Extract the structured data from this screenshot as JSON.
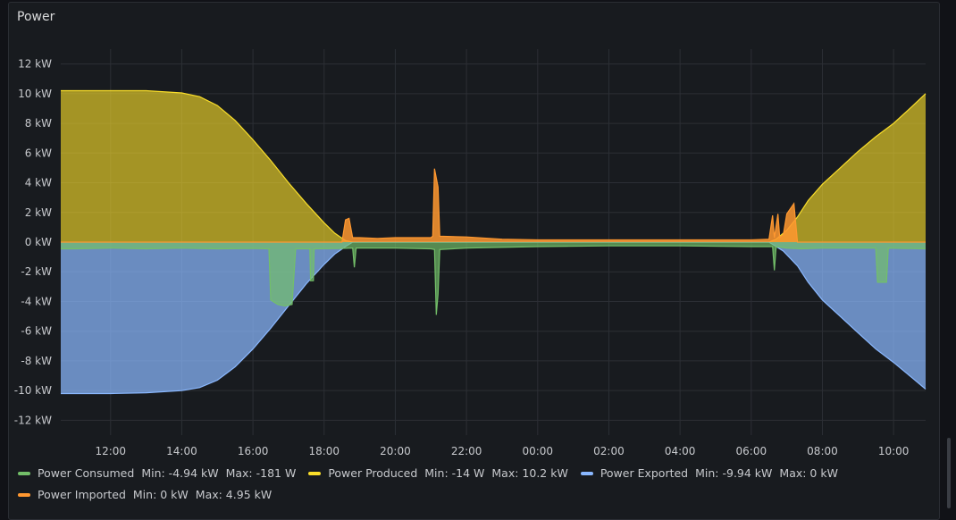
{
  "panel": {
    "title": "Power"
  },
  "colors": {
    "consumed": "#73bf69",
    "produced": "#fade2a",
    "exported": "#8ab8ff",
    "imported": "#ff9830",
    "grid": "#2c2f35",
    "background": "#181b1f"
  },
  "chart_data": {
    "type": "area",
    "title": "Power",
    "xlabel": "",
    "ylabel": "",
    "ylim": [
      -13,
      13
    ],
    "y_ticks": [
      12,
      10,
      8,
      6,
      4,
      2,
      0,
      -2,
      -4,
      -6,
      -8,
      -10,
      -12
    ],
    "y_tick_labels": [
      "12 kW",
      "10 kW",
      "8 kW",
      "6 kW",
      "4 kW",
      "2 kW",
      "0 kW",
      "-2 kW",
      "-4 kW",
      "-6 kW",
      "-8 kW",
      "-10 kW",
      "-12 kW"
    ],
    "x_range_hours": [
      10.6,
      34.9
    ],
    "x_ticks": [
      12,
      14,
      16,
      18,
      20,
      22,
      24,
      26,
      28,
      30,
      32,
      34
    ],
    "x_tick_labels": [
      "12:00",
      "14:00",
      "16:00",
      "18:00",
      "20:00",
      "22:00",
      "00:00",
      "02:00",
      "04:00",
      "06:00",
      "08:00",
      "10:00"
    ],
    "grid": true,
    "legend_position": "bottom-left",
    "series": [
      {
        "name": "Power Produced",
        "key": "produced",
        "points": [
          [
            10.6,
            10.2
          ],
          [
            11,
            10.2
          ],
          [
            12,
            10.2
          ],
          [
            13,
            10.2
          ],
          [
            14,
            10.05
          ],
          [
            14.5,
            9.8
          ],
          [
            15,
            9.2
          ],
          [
            15.5,
            8.2
          ],
          [
            16,
            6.9
          ],
          [
            16.5,
            5.5
          ],
          [
            17,
            4.0
          ],
          [
            17.5,
            2.6
          ],
          [
            18,
            1.3
          ],
          [
            18.3,
            0.6
          ],
          [
            18.6,
            0.1
          ],
          [
            18.8,
            0
          ],
          [
            30.5,
            0
          ],
          [
            30.7,
            0.2
          ],
          [
            31,
            0.8
          ],
          [
            31.3,
            1.7
          ],
          [
            31.6,
            2.8
          ],
          [
            32,
            3.9
          ],
          [
            32.5,
            5.0
          ],
          [
            33,
            6.1
          ],
          [
            33.5,
            7.1
          ],
          [
            34,
            8.0
          ],
          [
            34.5,
            9.1
          ],
          [
            34.9,
            10.0
          ]
        ]
      },
      {
        "name": "Power Exported",
        "key": "exported",
        "points": [
          [
            10.6,
            -10.2
          ],
          [
            11,
            -10.2
          ],
          [
            12,
            -10.2
          ],
          [
            13,
            -10.15
          ],
          [
            14,
            -10.0
          ],
          [
            14.5,
            -9.8
          ],
          [
            15,
            -9.3
          ],
          [
            15.5,
            -8.4
          ],
          [
            16,
            -7.2
          ],
          [
            16.5,
            -5.8
          ],
          [
            17,
            -4.3
          ],
          [
            17.5,
            -2.8
          ],
          [
            18,
            -1.5
          ],
          [
            18.3,
            -0.8
          ],
          [
            18.6,
            -0.3
          ],
          [
            18.8,
            0
          ],
          [
            30.5,
            0
          ],
          [
            30.9,
            -0.6
          ],
          [
            31.3,
            -1.6
          ],
          [
            31.6,
            -2.7
          ],
          [
            32,
            -3.9
          ],
          [
            32.5,
            -5.0
          ],
          [
            33,
            -6.1
          ],
          [
            33.5,
            -7.2
          ],
          [
            34,
            -8.1
          ],
          [
            34.5,
            -9.1
          ],
          [
            34.9,
            -9.9
          ]
        ]
      },
      {
        "name": "Power Consumed",
        "key": "consumed",
        "points": [
          [
            10.6,
            -0.45
          ],
          [
            11,
            -0.45
          ],
          [
            12,
            -0.4
          ],
          [
            13,
            -0.45
          ],
          [
            14,
            -0.4
          ],
          [
            15,
            -0.45
          ],
          [
            16,
            -0.42
          ],
          [
            16.45,
            -0.45
          ],
          [
            16.5,
            -3.9
          ],
          [
            16.7,
            -4.2
          ],
          [
            16.9,
            -4.3
          ],
          [
            17.1,
            -4.2
          ],
          [
            17.2,
            -0.45
          ],
          [
            17.6,
            -0.45
          ],
          [
            17.62,
            -2.6
          ],
          [
            17.7,
            -2.6
          ],
          [
            17.72,
            -0.45
          ],
          [
            18.5,
            -0.42
          ],
          [
            18.8,
            -0.4
          ],
          [
            18.85,
            -1.7
          ],
          [
            18.9,
            -0.4
          ],
          [
            20,
            -0.4
          ],
          [
            21,
            -0.45
          ],
          [
            21.1,
            -0.5
          ],
          [
            21.15,
            -4.9
          ],
          [
            21.2,
            -3.5
          ],
          [
            21.25,
            -0.5
          ],
          [
            22,
            -0.4
          ],
          [
            24,
            -0.3
          ],
          [
            26,
            -0.25
          ],
          [
            28,
            -0.25
          ],
          [
            30,
            -0.3
          ],
          [
            30.6,
            -0.3
          ],
          [
            30.65,
            -1.9
          ],
          [
            30.7,
            -0.3
          ],
          [
            31,
            -0.4
          ],
          [
            31.4,
            -0.45
          ],
          [
            32,
            -0.4
          ],
          [
            33,
            -0.4
          ],
          [
            33.5,
            -0.4
          ],
          [
            33.55,
            -2.7
          ],
          [
            33.8,
            -2.7
          ],
          [
            33.85,
            -0.4
          ],
          [
            34.9,
            -0.45
          ]
        ]
      },
      {
        "name": "Power Imported",
        "key": "imported",
        "points": [
          [
            10.6,
            0
          ],
          [
            18.5,
            0
          ],
          [
            18.6,
            1.5
          ],
          [
            18.7,
            1.6
          ],
          [
            18.8,
            0.3
          ],
          [
            19,
            0.3
          ],
          [
            19.5,
            0.25
          ],
          [
            20,
            0.3
          ],
          [
            21,
            0.3
          ],
          [
            21.05,
            0.4
          ],
          [
            21.1,
            4.95
          ],
          [
            21.2,
            3.7
          ],
          [
            21.25,
            0.4
          ],
          [
            22,
            0.35
          ],
          [
            23,
            0.2
          ],
          [
            24,
            0.15
          ],
          [
            26,
            0.15
          ],
          [
            28,
            0.15
          ],
          [
            30,
            0.15
          ],
          [
            30.5,
            0.2
          ],
          [
            30.6,
            1.8
          ],
          [
            30.65,
            0.3
          ],
          [
            30.75,
            1.9
          ],
          [
            30.8,
            0.3
          ],
          [
            30.9,
            0.5
          ],
          [
            31.0,
            1.9
          ],
          [
            31.2,
            2.6
          ],
          [
            31.3,
            0
          ],
          [
            34.9,
            0
          ]
        ]
      }
    ]
  },
  "legend": [
    {
      "key": "consumed",
      "name": "Power Consumed",
      "min": "Min: -4.94 kW",
      "max": "Max: -181 W"
    },
    {
      "key": "produced",
      "name": "Power Produced",
      "min": "Min: -14 W",
      "max": "Max: 10.2 kW"
    },
    {
      "key": "exported",
      "name": "Power Exported",
      "min": "Min: -9.94 kW",
      "max": "Max: 0 kW"
    },
    {
      "key": "imported",
      "name": "Power Imported",
      "min": "Min: 0 kW",
      "max": "Max: 4.95 kW"
    }
  ]
}
